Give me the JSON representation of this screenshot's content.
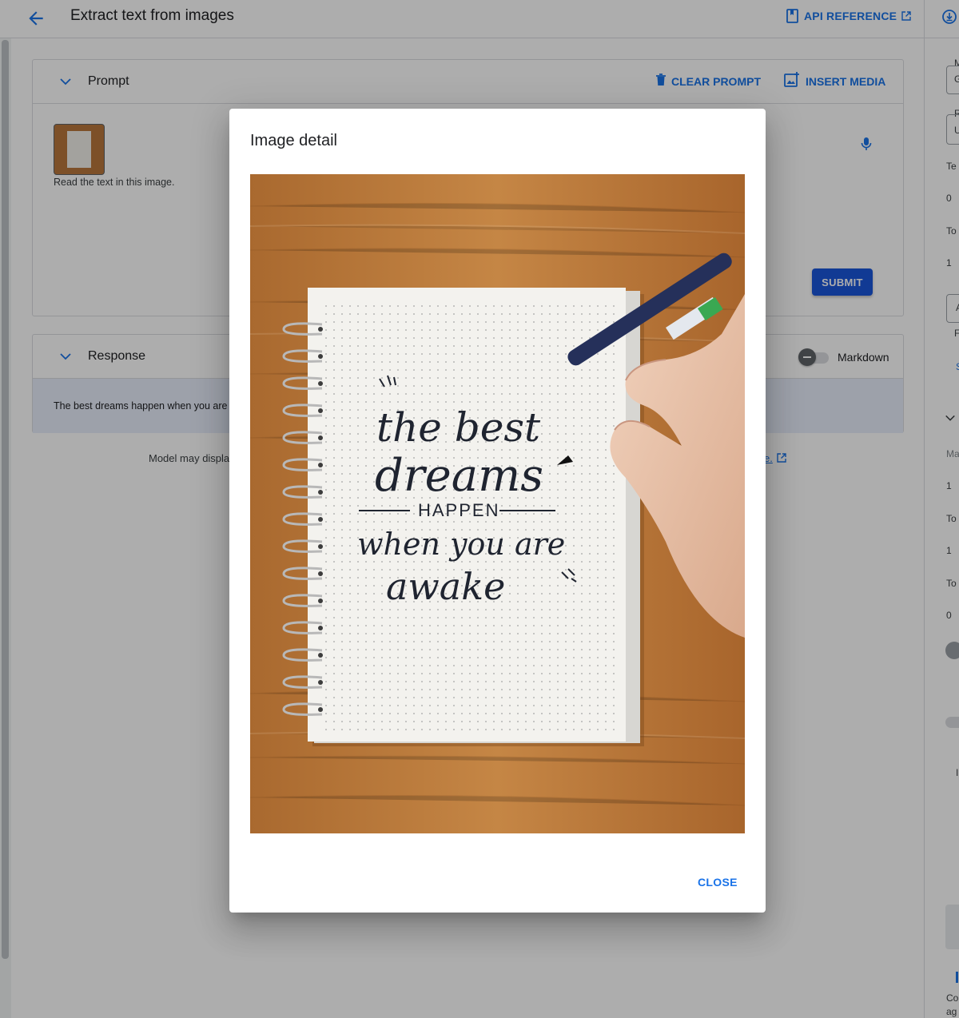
{
  "topbar": {
    "title": "Extract text from images",
    "api_reference_label": "API REFERENCE"
  },
  "prompt_card": {
    "title": "Prompt",
    "clear_prompt_label": "CLEAR PROMPT",
    "insert_media_label": "INSERT MEDIA",
    "prompt_text": "Read the text in this image.",
    "submit_label": "SUBMIT"
  },
  "response_card": {
    "title": "Response",
    "response_text": "The best dreams happen when you are",
    "markdown_label": "Markdown"
  },
  "disclaimer": {
    "text": "Model may displa",
    "link_text": "e."
  },
  "right_panel": {
    "labels": [
      "M",
      "G",
      "R",
      "U",
      "Te",
      "0",
      "To",
      "1",
      "A",
      "F",
      "S",
      "Ma",
      "1",
      "To",
      "1",
      "To",
      "0",
      "I",
      "Co",
      "ag"
    ]
  },
  "dialog": {
    "title": "Image detail",
    "image": {
      "handwriting": [
        "the best",
        "dreams",
        "HAPPEN",
        "when you are",
        "awake"
      ]
    },
    "close_label": "CLOSE"
  },
  "colors": {
    "accent": "#1a73e8",
    "submit": "#1a56db",
    "response_bg": "#e8eefb",
    "scrim": "rgba(0,0,0,0.32)"
  }
}
